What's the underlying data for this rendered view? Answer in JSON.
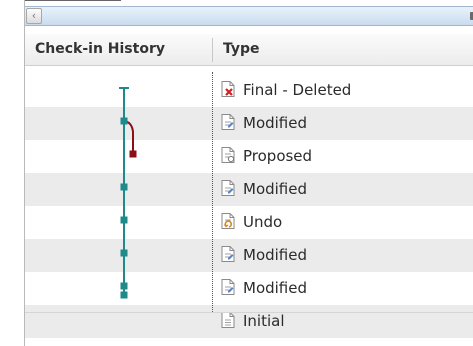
{
  "header": {
    "history_label": "Check-in History",
    "type_label": "Type"
  },
  "rows": [
    {
      "type": "Final - Deleted",
      "icon": "deleted-document-icon"
    },
    {
      "type": "Modified",
      "icon": "modified-document-icon"
    },
    {
      "type": "Proposed",
      "icon": "proposed-document-icon"
    },
    {
      "type": "Modified",
      "icon": "modified-document-icon"
    },
    {
      "type": "Undo",
      "icon": "undo-document-icon"
    },
    {
      "type": "Modified",
      "icon": "modified-document-icon"
    },
    {
      "type": "Modified",
      "icon": "modified-document-icon"
    },
    {
      "type": "Initial",
      "icon": "initial-document-icon"
    }
  ],
  "colors": {
    "branch_main": "#1e8a8a",
    "branch_proposed": "#8b0f14",
    "row_alt": "#ebebeb"
  }
}
